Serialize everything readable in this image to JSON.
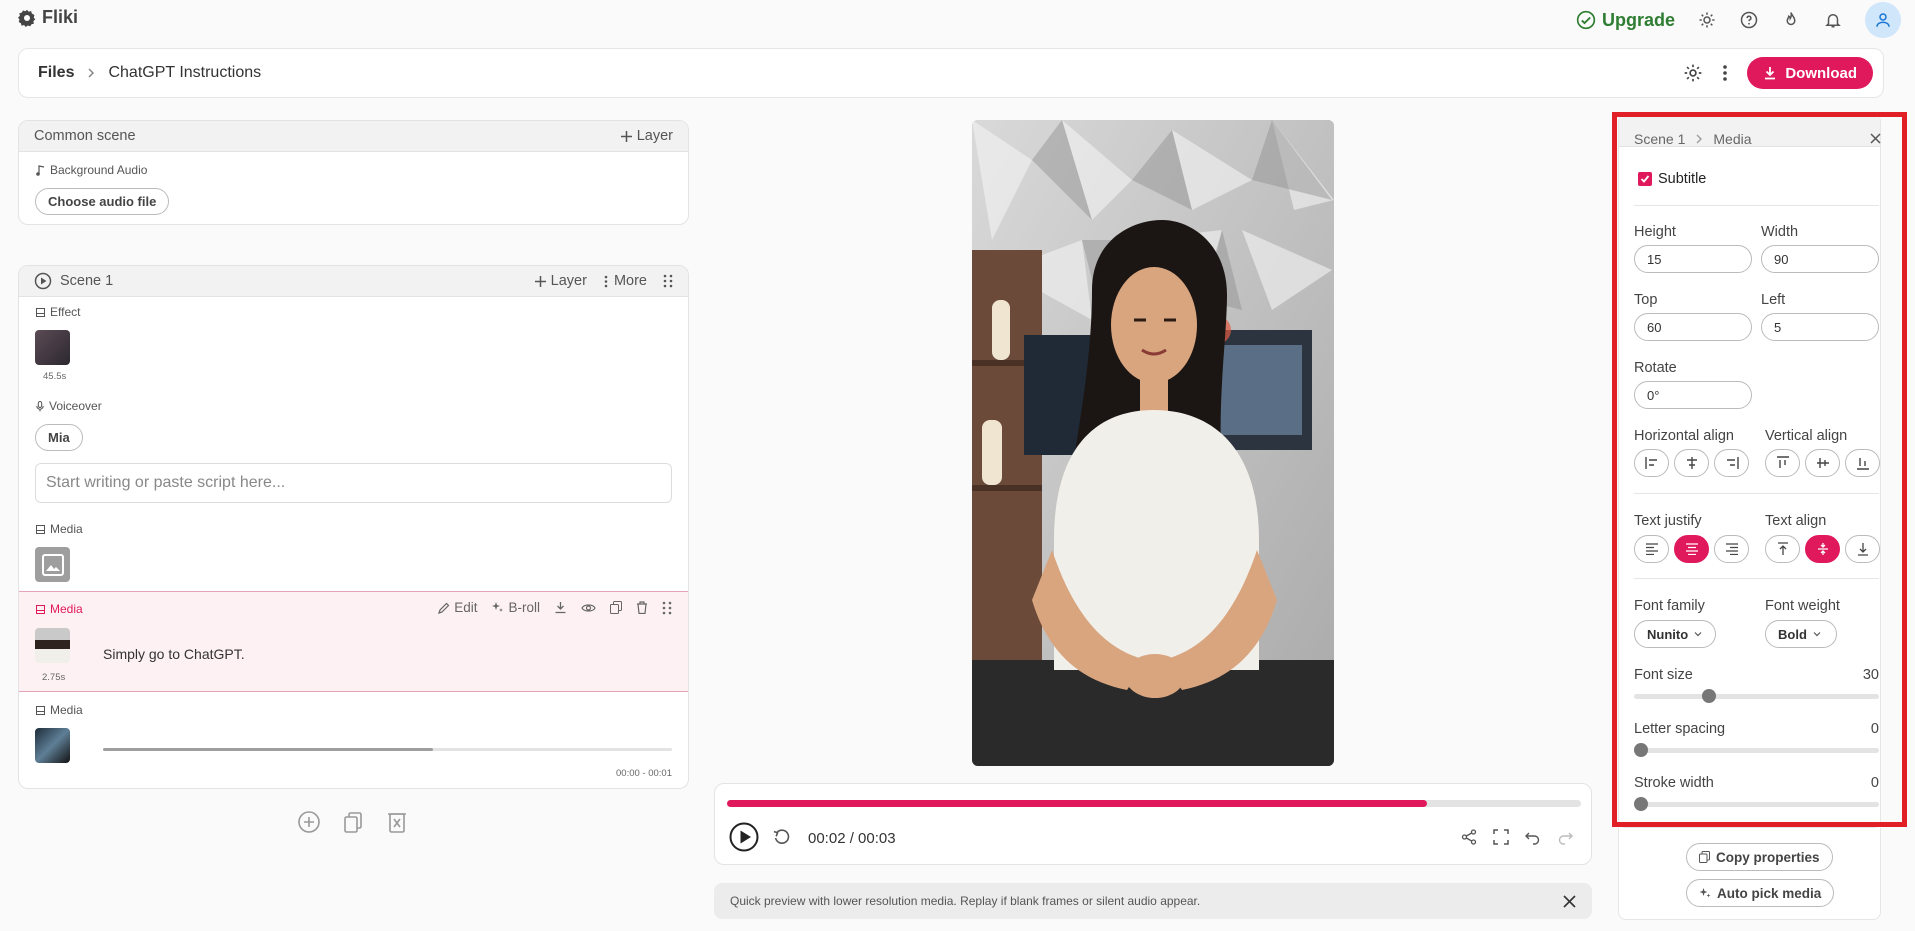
{
  "app": {
    "name": "Fliki"
  },
  "top": {
    "upgrade_label": "Upgrade"
  },
  "breadcrumb": {
    "root": "Files",
    "current": "ChatGPT Instructions"
  },
  "toolbar": {
    "download_label": "Download"
  },
  "common_scene": {
    "title": "Common scene",
    "layer_label": "Layer",
    "bg_audio_label": "Background Audio",
    "choose_audio_label": "Choose audio file"
  },
  "scene1": {
    "title": "Scene 1",
    "layer_label": "Layer",
    "more_label": "More",
    "effect_label": "Effect",
    "effect_duration": "45.5s",
    "voiceover_label": "Voiceover",
    "voice_name": "Mia",
    "script_placeholder": "Start writing or paste script here...",
    "media1_label": "Media",
    "media2_label": "Media",
    "media2_edit": "Edit",
    "media2_broll": "B-roll",
    "media2_text": "Simply go to ChatGPT.",
    "media2_duration": "2.75s",
    "media3_label": "Media",
    "media3_time": "00:00 - 00:01",
    "media3_progress": 0.58
  },
  "player": {
    "time": "00:02 / 00:03",
    "progress": 0.82
  },
  "notice": {
    "text": "Quick preview with lower resolution media. Replay if blank frames or silent audio appear."
  },
  "panel": {
    "crumb_scene": "Scene 1",
    "crumb_media": "Media",
    "subtitle_label": "Subtitle",
    "subtitle_checked": true,
    "height_label": "Height",
    "height_value": "15",
    "width_label": "Width",
    "width_value": "90",
    "top_label": "Top",
    "top_value": "60",
    "left_label": "Left",
    "left_value": "5",
    "rotate_label": "Rotate",
    "rotate_value": "0°",
    "halign_label": "Horizontal align",
    "valign_label": "Vertical align",
    "tjustify_label": "Text justify",
    "talign_label": "Text align",
    "font_family_label": "Font family",
    "font_family_value": "Nunito",
    "font_weight_label": "Font weight",
    "font_weight_value": "Bold",
    "font_size_label": "Font size",
    "font_size_value": "30",
    "letter_spacing_label": "Letter spacing",
    "letter_spacing_value": "0",
    "stroke_width_label": "Stroke width",
    "stroke_width_value": "0",
    "copy_props_label": "Copy properties",
    "auto_pick_label": "Auto pick media"
  },
  "colors": {
    "accent": "#e0195c",
    "upgrade": "#2e7d32",
    "highlight": "#e01f26"
  }
}
